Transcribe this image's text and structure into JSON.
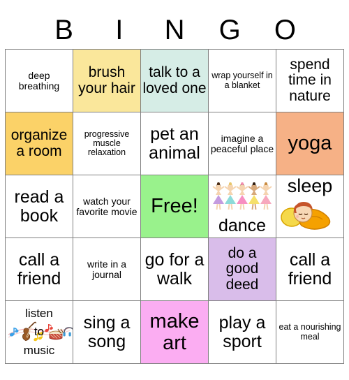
{
  "header": {
    "letters": [
      "B",
      "I",
      "N",
      "G",
      "O"
    ]
  },
  "colors": {
    "white": "#FFFFFF",
    "yellow": "#FAE79B",
    "teal": "#D6EDE6",
    "gold": "#FBD268",
    "peach": "#F6B186",
    "green": "#99F28C",
    "purple": "#D9BDEA",
    "pink": "#FBADF2",
    "border": "#808080",
    "text": "#000000"
  },
  "grid": {
    "rows": [
      [
        {
          "text": "deep breathing",
          "bg": "#FFFFFF",
          "size": "fs-sm"
        },
        {
          "text": "brush your hair",
          "bg": "#FAE79B",
          "size": "fs-md"
        },
        {
          "text": "talk to a loved one",
          "bg": "#D6EDE6",
          "size": "fs-md"
        },
        {
          "text": "wrap yourself in a blanket",
          "bg": "#FFFFFF",
          "size": "fs-xs"
        },
        {
          "text": "spend time in nature",
          "bg": "#FFFFFF",
          "size": "fs-md"
        }
      ],
      [
        {
          "text": "organize a room",
          "bg": "#FBD268",
          "size": "fs-md"
        },
        {
          "text": "progressive muscle relaxation",
          "bg": "#FFFFFF",
          "size": "fs-xs"
        },
        {
          "text": "pet an animal",
          "bg": "#FFFFFF",
          "size": "fs-lg"
        },
        {
          "text": "imagine a peaceful place",
          "bg": "#FFFFFF",
          "size": "fs-sm"
        },
        {
          "text": "yoga",
          "bg": "#F6B186",
          "size": "fs-xl"
        }
      ],
      [
        {
          "text": "read a book",
          "bg": "#FFFFFF",
          "size": "fs-lg"
        },
        {
          "text": "watch your favorite movie",
          "bg": "#FFFFFF",
          "size": "fs-sm"
        },
        {
          "text": "Free!",
          "bg": "#99F28C",
          "size": "fs-xl"
        },
        {
          "text": "dance",
          "bg": "#FFFFFF",
          "size": "fs-lg",
          "clipart": "ballerinas-clipart"
        },
        {
          "text": "sleep",
          "bg": "#FFFFFF",
          "size": "fs-lg",
          "clipart": "sleeping-child-clipart"
        }
      ],
      [
        {
          "text": "call a friend",
          "bg": "#FFFFFF",
          "size": "fs-lg"
        },
        {
          "text": "write in a journal",
          "bg": "#FFFFFF",
          "size": "fs-sm"
        },
        {
          "text": "go for a walk",
          "bg": "#FFFFFF",
          "size": "fs-lg"
        },
        {
          "text": "do a good deed",
          "bg": "#D9BDEA",
          "size": "fs-md"
        },
        {
          "text": "call a friend",
          "bg": "#FFFFFF",
          "size": "fs-lg"
        }
      ],
      [
        {
          "text": "listen to music",
          "bg": "#FFFFFF",
          "size": "fs-sm",
          "clipart": "music-instruments-clipart"
        },
        {
          "text": "sing a song",
          "bg": "#FFFFFF",
          "size": "fs-lg"
        },
        {
          "text": "make art",
          "bg": "#FBADF2",
          "size": "fs-xl"
        },
        {
          "text": "play a sport",
          "bg": "#FFFFFF",
          "size": "fs-lg"
        },
        {
          "text": "eat a nourishing meal",
          "bg": "#FFFFFF",
          "size": "fs-xs"
        }
      ]
    ],
    "music_cell": {
      "line1": "listen",
      "line2": "to",
      "line3": "music"
    },
    "dance_cell": {
      "label": "dance"
    },
    "sleep_cell": {
      "label": "sleep"
    }
  }
}
